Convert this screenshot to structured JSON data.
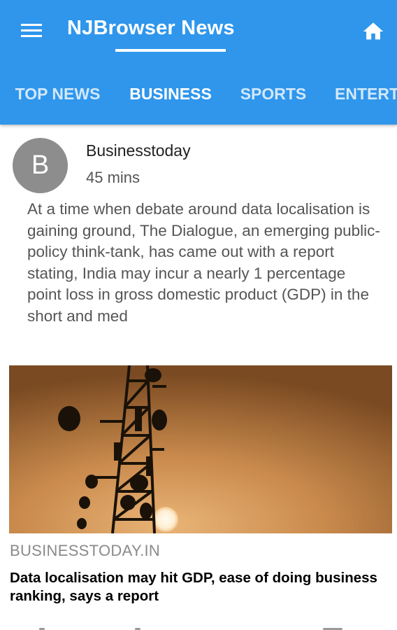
{
  "app": {
    "title": "NJBrowser News",
    "colors": {
      "appbar": "#2f96ec",
      "text_on_appbar": "#ffffff"
    },
    "icons": {
      "menu": "menu-icon",
      "home": "home-icon"
    }
  },
  "tabs": [
    {
      "label": "TOP NEWS",
      "active": false
    },
    {
      "label": "BUSINESS",
      "active": true
    },
    {
      "label": "SPORTS",
      "active": false
    },
    {
      "label": "ENTERT",
      "active": false
    }
  ],
  "article": {
    "avatar_letter": "B",
    "source": "Businesstoday",
    "time": "45 mins",
    "summary": "At a time when debate around data localisation is gaining ground, The Dialogue, an emerging public-policy think-tank, has came out with a report stating, India may incur a nearly 1 percentage point loss in gross domestic product (GDP) in the short and med",
    "domain": "BUSINESSTODAY.IN",
    "headline": "Data localisation may hit GDP, ease of doing business ranking, says a report"
  }
}
